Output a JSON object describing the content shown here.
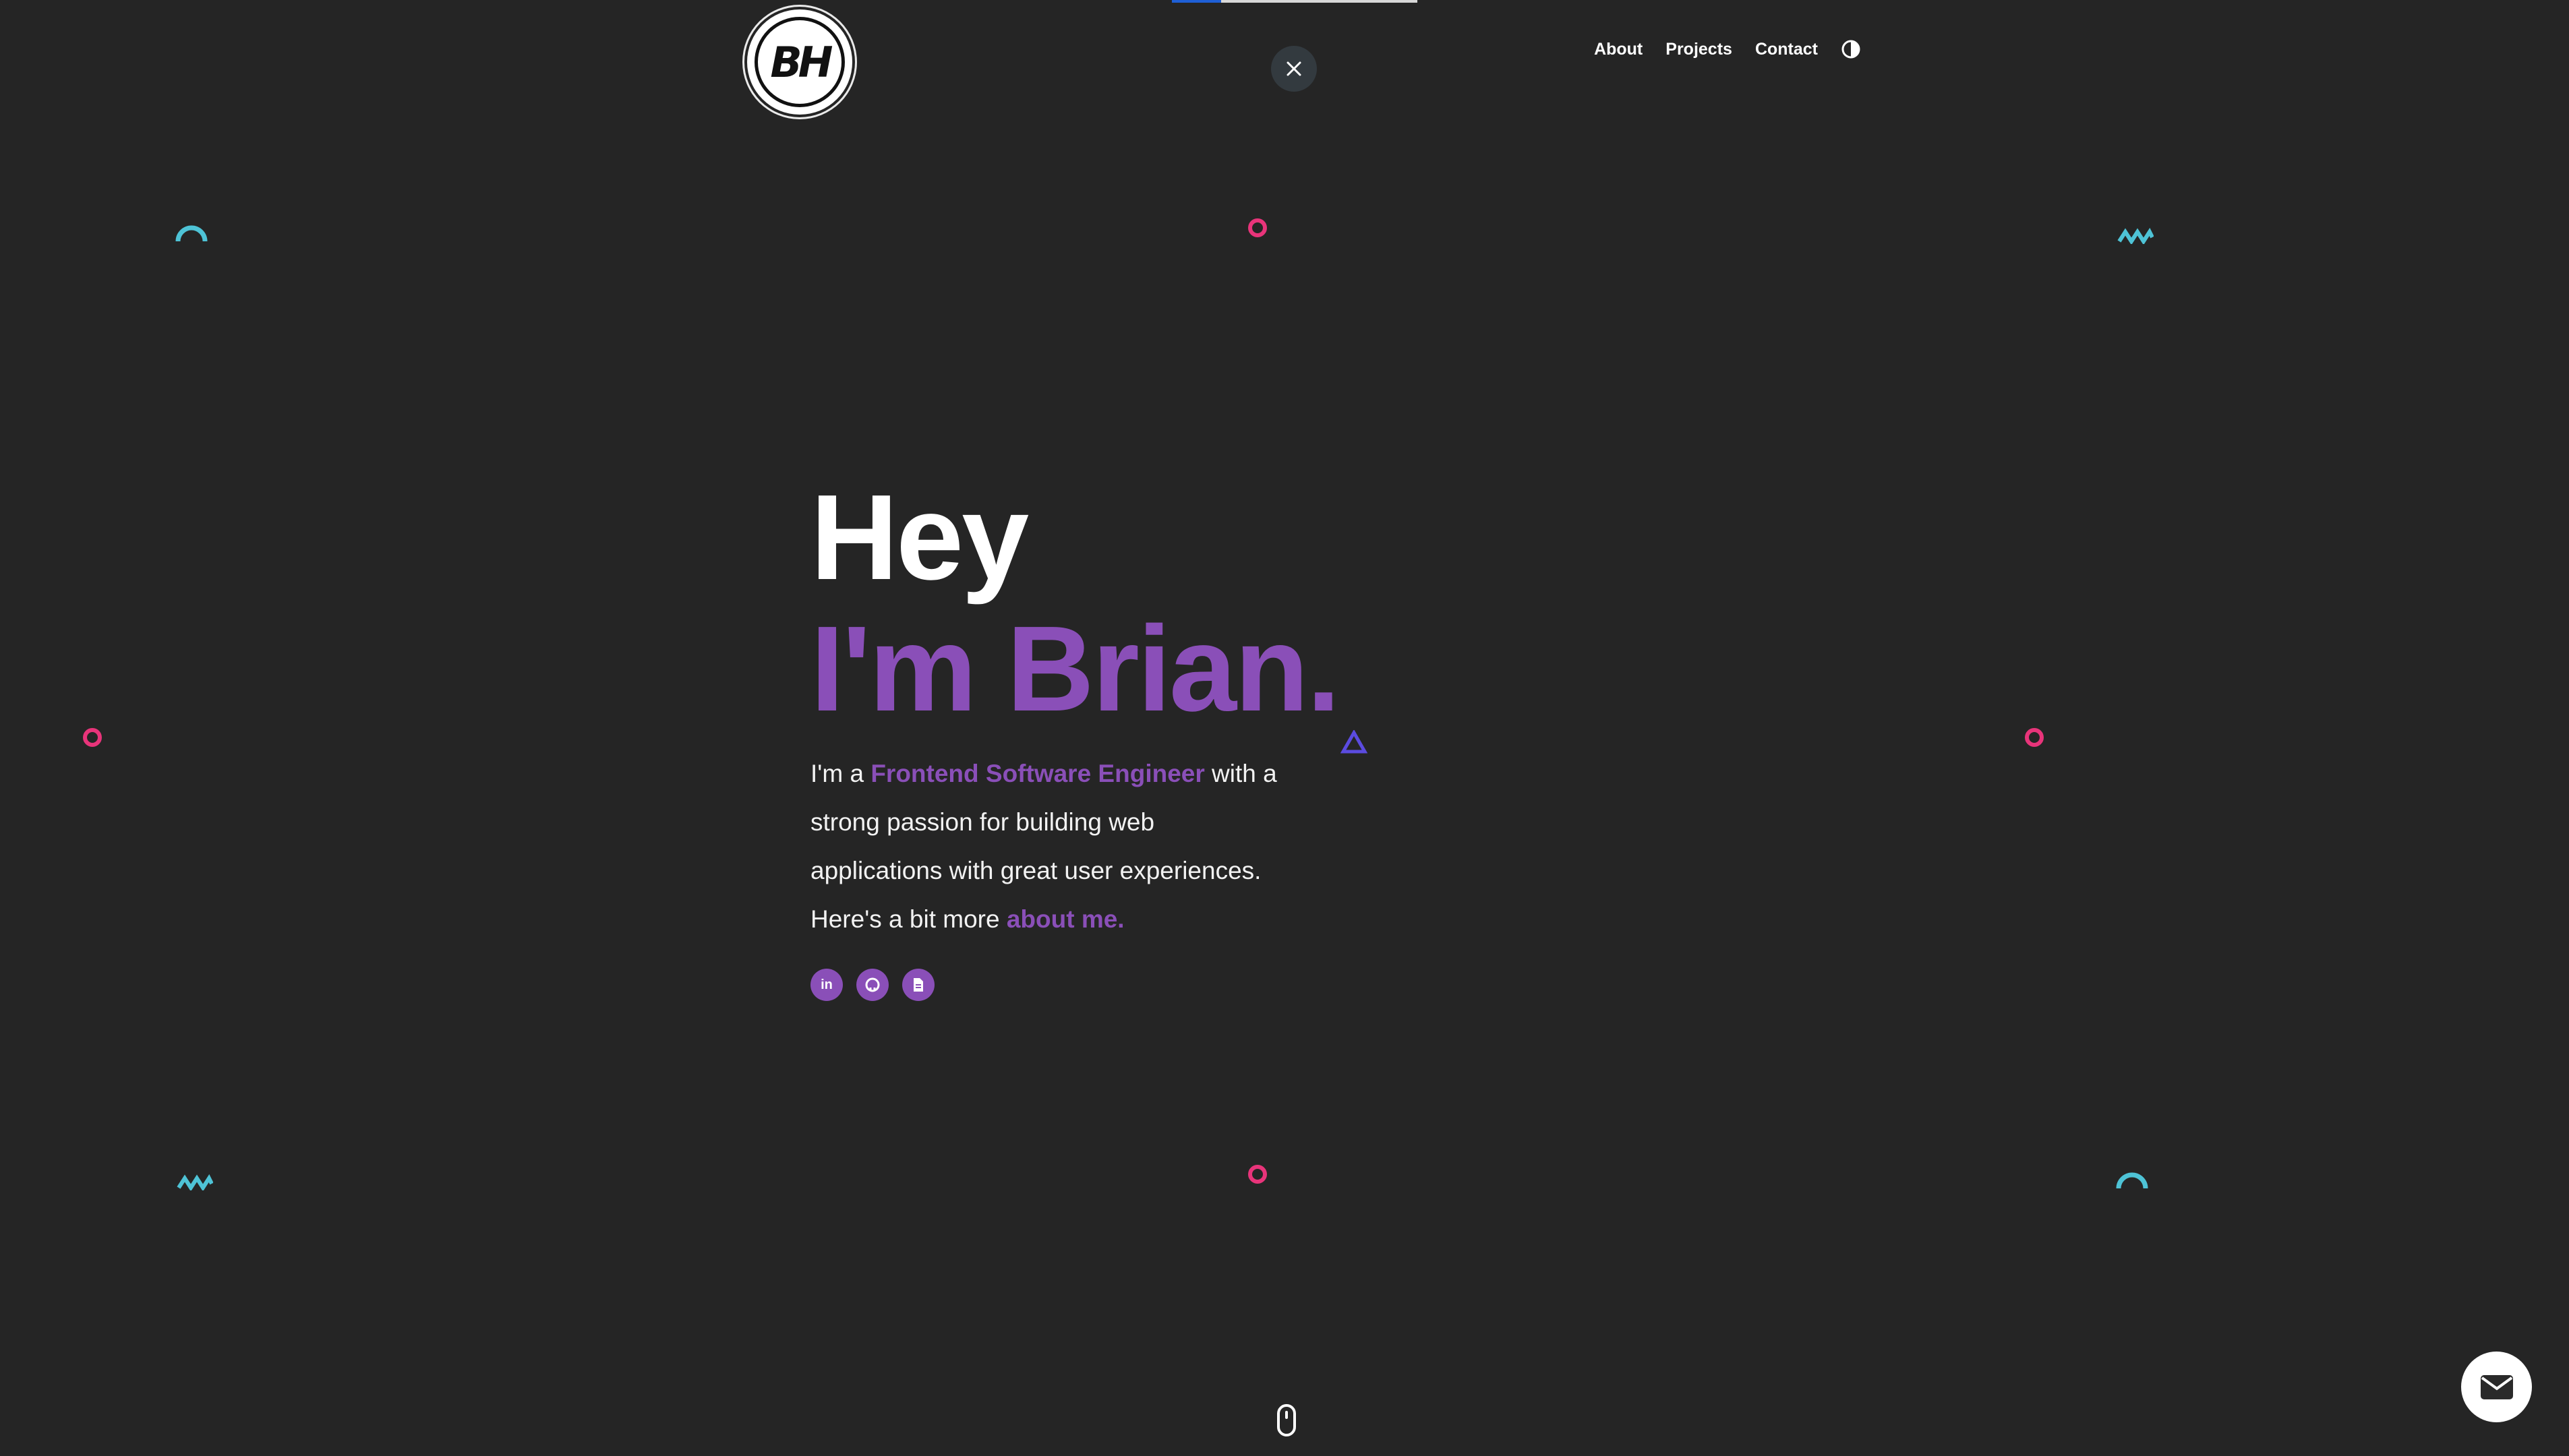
{
  "header": {
    "logo_text": "BH",
    "close_label": "Close",
    "nav": [
      {
        "label": "About"
      },
      {
        "label": "Projects"
      },
      {
        "label": "Contact"
      }
    ],
    "theme_toggle_icon": "contrast-icon",
    "progress_fraction": 0.2
  },
  "hero": {
    "line1": "Hey",
    "line2": "I'm Brian.",
    "desc_prefix": "I'm a ",
    "desc_role": "Frontend Software Engineer",
    "desc_mid": " with a strong passion for building web applications with great user experiences. Here's a bit more ",
    "desc_link": "about me."
  },
  "socials": [
    {
      "name": "linkedin-icon",
      "glyph": "in"
    },
    {
      "name": "github-icon",
      "glyph": ""
    },
    {
      "name": "resume-icon",
      "glyph": ""
    }
  ],
  "colors": {
    "background": "#252525",
    "accent_purple": "#8a4fb8",
    "shape_pink": "#e8347a",
    "shape_cyan": "#4ec3d6",
    "shape_violet": "#5b4be0"
  }
}
